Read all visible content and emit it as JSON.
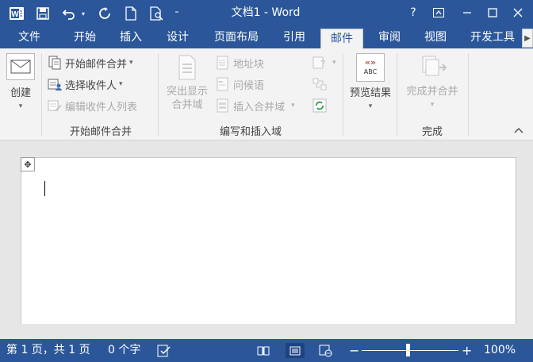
{
  "app": {
    "title": "文档1 - Word",
    "help": "?"
  },
  "tabs": {
    "file": "文件",
    "items": [
      {
        "label": "开始"
      },
      {
        "label": "插入"
      },
      {
        "label": "设计"
      },
      {
        "label": "页面布局"
      },
      {
        "label": "引用"
      },
      {
        "label": "邮件"
      },
      {
        "label": "审阅"
      },
      {
        "label": "视图"
      },
      {
        "label": "开发工具"
      }
    ],
    "active": "邮件"
  },
  "ribbon": {
    "create": {
      "label": "创建",
      "group": ""
    },
    "start_merge": {
      "group": "开始邮件合并",
      "start": "开始邮件合并",
      "select": "选择收件人",
      "edit": "编辑收件人列表"
    },
    "write_insert": {
      "group": "编写和插入域",
      "highlight_line1": "突出显示",
      "highlight_line2": "合并域",
      "address": "地址块",
      "greeting": "问候语",
      "insert_field": "插入合并域"
    },
    "preview": {
      "label": "预览结果",
      "icon_text": "ABC",
      "icon_sym": "«»"
    },
    "finish": {
      "group": "完成",
      "label": "完成并合并"
    }
  },
  "status": {
    "page": "第 1 页，共 1 页",
    "words": "0 个字",
    "zoom": "100%",
    "minus": "−",
    "plus": "+"
  },
  "colors": {
    "brand": "#2b579a",
    "ribbon": "#f3f3f3",
    "accent": "#c0504d"
  }
}
